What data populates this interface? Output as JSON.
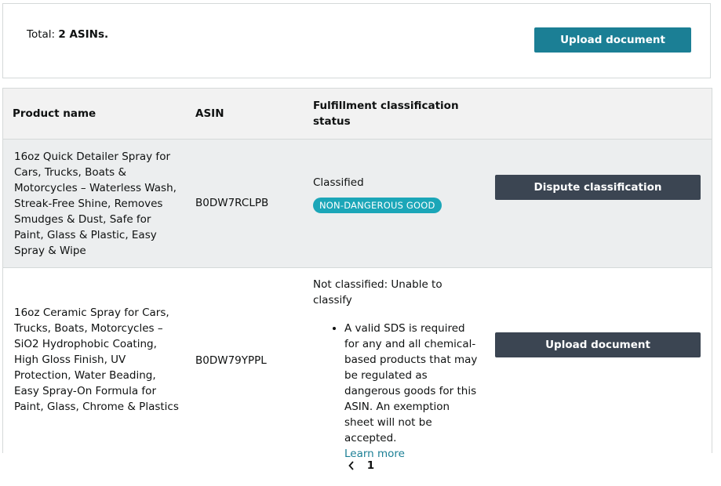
{
  "summary": {
    "total_prefix": "Total: ",
    "total_value": "2 ASINs.",
    "upload_label": "Upload document"
  },
  "table": {
    "headers": {
      "product_name": "Product name",
      "asin": "ASIN",
      "status": "Fulfillment classification status"
    },
    "rows": [
      {
        "product_name": "16oz Quick Detailer Spray for Cars, Trucks, Boats & Motorcycles – Waterless Wash, Streak-Free Shine, Removes Smudges & Dust, Safe for Paint, Glass & Plastic, Easy Spray & Wipe",
        "asin": "B0DW7RCLPB",
        "status": "Classified",
        "badge": "NON-DANGEROUS GOOD",
        "action_label": "Dispute classification"
      },
      {
        "product_name": "16oz Ceramic Spray for Cars, Trucks, Boats, Motorcycles – SiO2 Hydrophobic Coating, High Gloss Finish, UV Protection, Water Beading, Easy Spray-On Formula for Paint, Glass, Chrome & Plastics",
        "asin": "B0DW79YPPL",
        "status": "Not classified: Unable to classify",
        "note": "A valid SDS is required for any and all chemical-based products that may be regulated as dangerous goods for this ASIN. An exemption sheet will not be accepted.",
        "learn_more": "Learn more",
        "action_label": "Upload document"
      }
    ]
  },
  "pagination": {
    "current_page": "1"
  },
  "colors": {
    "teal_button": "#1b7f95",
    "dark_button": "#3b4552",
    "badge": "#1ba6b8",
    "link": "#1b7f95"
  }
}
